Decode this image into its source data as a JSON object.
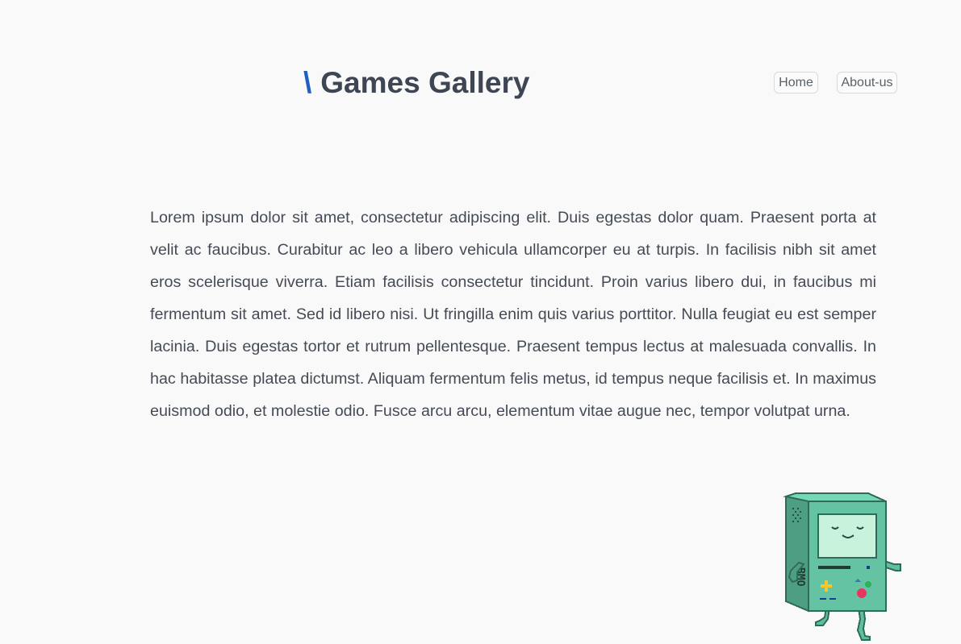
{
  "header": {
    "brand_slash": "\\",
    "brand_title": "Games Gallery"
  },
  "nav": {
    "items": [
      {
        "label": "Home"
      },
      {
        "label": "About-us"
      }
    ]
  },
  "main": {
    "paragraph": "Lorem ipsum dolor sit amet, consectetur adipiscing elit. Duis egestas dolor quam. Praesent porta at velit ac faucibus. Curabitur ac leo a libero vehicula ullamcorper eu at turpis. In facilisis nibh sit amet eros scelerisque viverra. Etiam facilisis consectetur tincidunt. Proin varius libero dui, in faucibus mi fermentum sit amet. Sed id libero nisi. Ut fringilla enim quis varius porttitor. Nulla feugiat eu est semper lacinia. Duis egestas tortor et rutrum pellentesque. Praesent tempus lectus at malesuada convallis. In hac habitasse platea dictumst. Aliquam fermentum felis metus, id tempus neque facilisis et. In maximus euismod odio, et molestie odio. Fusce arcu arcu, elementum vitae augue nec, tempor volutpat urna."
  },
  "mascot": {
    "name": "BMO",
    "icon": "bmo-pixel-mascot",
    "side_text": "BMO",
    "body_color": "#5fbf9e",
    "screen_color": "#c9f2dc"
  },
  "colors": {
    "accent": "#1f5fc1",
    "title": "#3e4653",
    "background": "#f9f9f9"
  }
}
